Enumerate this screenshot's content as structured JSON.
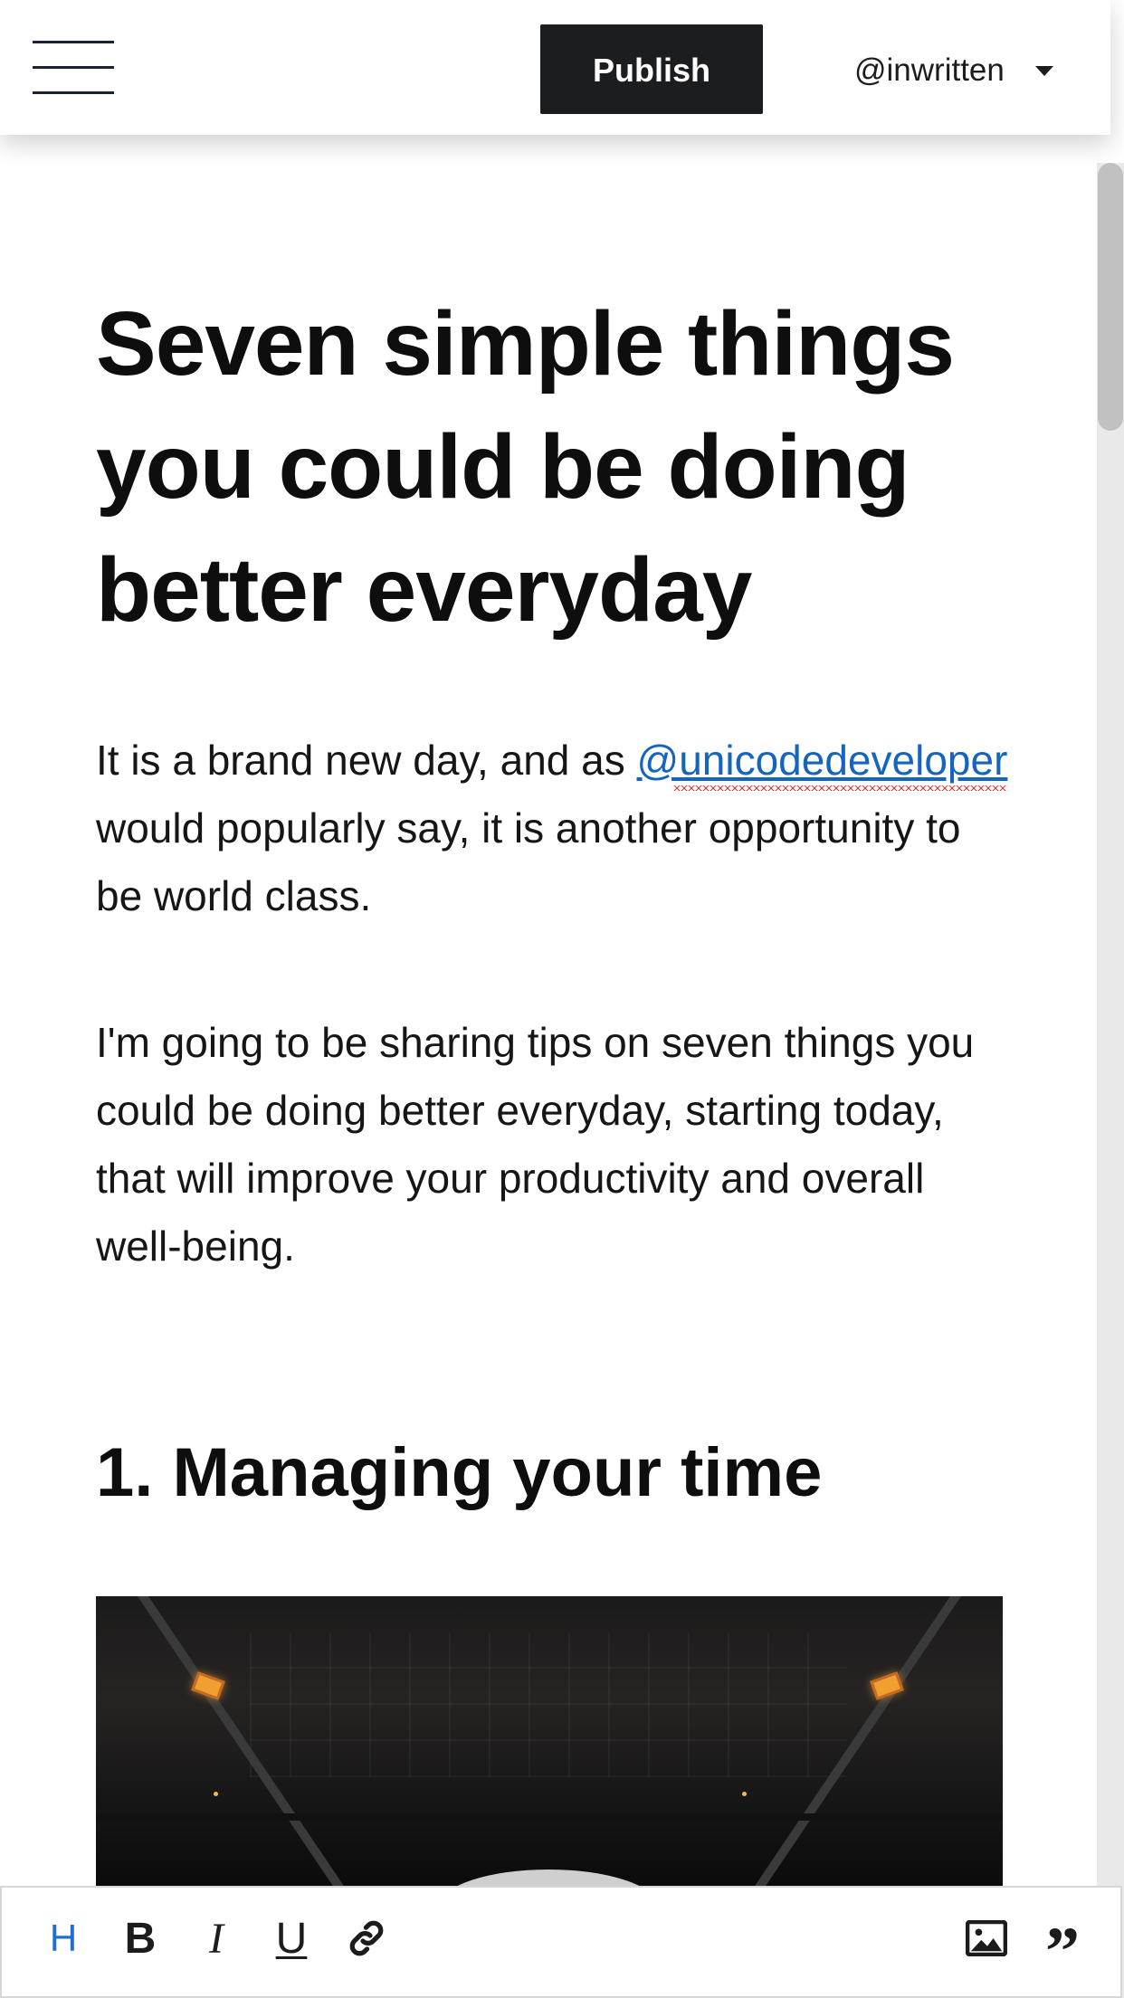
{
  "header": {
    "publish_label": "Publish",
    "username": "@inwritten"
  },
  "article": {
    "title": "Seven simple things you could be doing better everyday",
    "para1_before": "It is a brand new day, and as ",
    "para1_mention": "@unicodedeveloper",
    "para1_after": " would popularly say, it is another opportunity to be world class.",
    "para2": "I'm going to be sharing tips on seven things you could be doing better everyday, starting today, that will improve your productivity and overall well-being.",
    "heading1": "1. Managing your time"
  },
  "toolbar": {
    "heading_label": "H",
    "bold_label": "B",
    "italic_label": "I",
    "underline_label": "U",
    "quote_label": "”"
  },
  "icons": {
    "menu": "hamburger-icon",
    "dropdown": "caret-down-icon",
    "link": "link-icon",
    "image": "image-icon",
    "quote": "quote-icon"
  },
  "colors": {
    "publish_bg": "#1c1d1f",
    "link": "#1565c0",
    "heading_tool": "#1e6fd0",
    "spellcheck": "#e53935"
  }
}
